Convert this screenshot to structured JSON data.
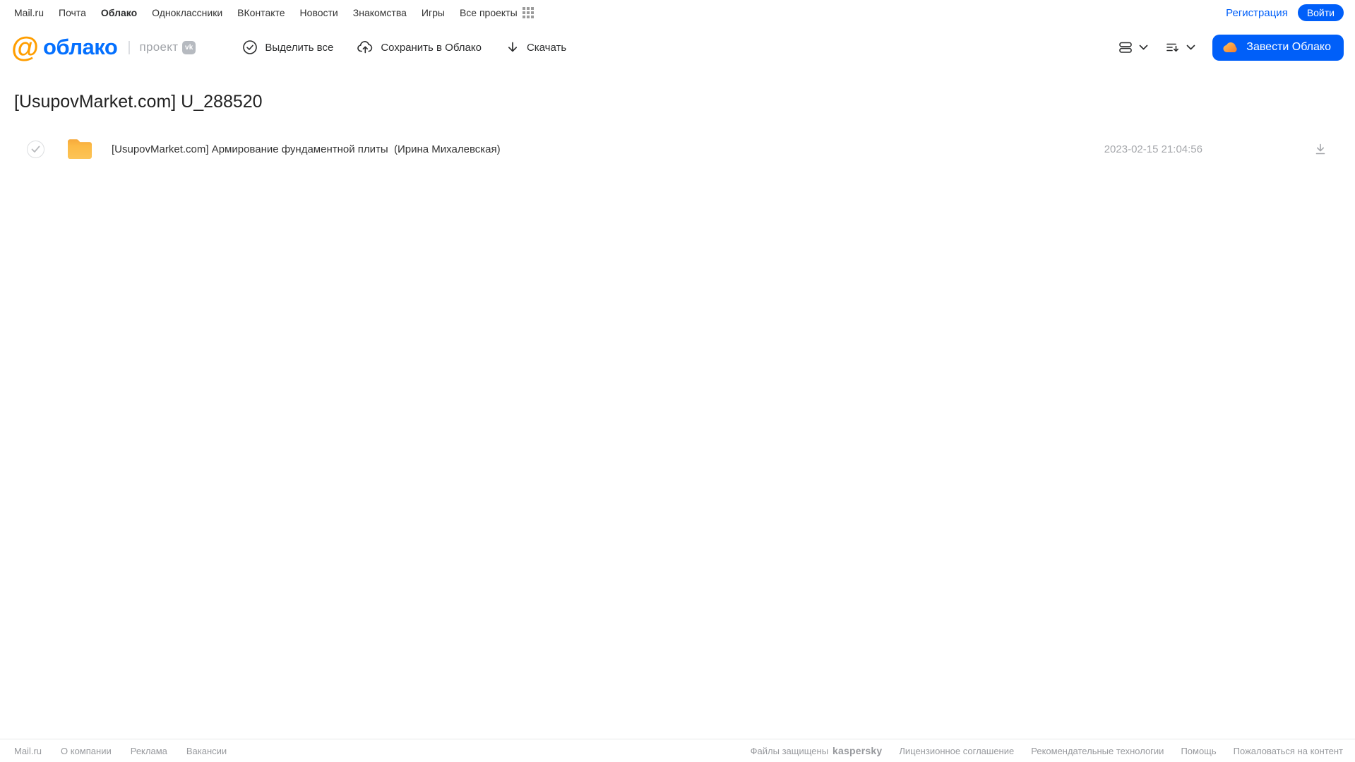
{
  "topnav": {
    "items": [
      "Mail.ru",
      "Почта",
      "Облако",
      "Одноклассники",
      "ВКонтакте",
      "Новости",
      "Знакомства",
      "Игры",
      "Все проекты"
    ],
    "registration_label": "Регистрация",
    "login_label": "Войти"
  },
  "header": {
    "logo_text": "облако",
    "logo_suffix": "проект",
    "vk_badge": "vk",
    "toolbar": {
      "select_all_label": "Выделить все",
      "save_to_cloud_label": "Сохранить в Облако",
      "download_label": "Скачать"
    },
    "get_cloud_label": "Завести Облако"
  },
  "main": {
    "title": "[UsupovMarket.com] U_288520",
    "rows": [
      {
        "name": "[UsupovMarket.com] Армирование фундаментной плиты  (Ирина Михалевская)",
        "date": "2023-02-15 21:04:56"
      }
    ]
  },
  "footer": {
    "left_links": [
      "Mail.ru",
      "О компании",
      "Реклама",
      "Вакансии"
    ],
    "protected_text": "Файлы защищены",
    "kaspersky_label": "kaspersky",
    "right_links": [
      "Лицензионное соглашение",
      "Рекомендательные технологии",
      "Помощь",
      "Пожаловаться на контент"
    ]
  },
  "colors": {
    "accent_blue": "#005ff9",
    "logo_orange": "#ff9e00",
    "folder_yellow": "#fcb83f",
    "kaspersky_green": "#009982"
  }
}
